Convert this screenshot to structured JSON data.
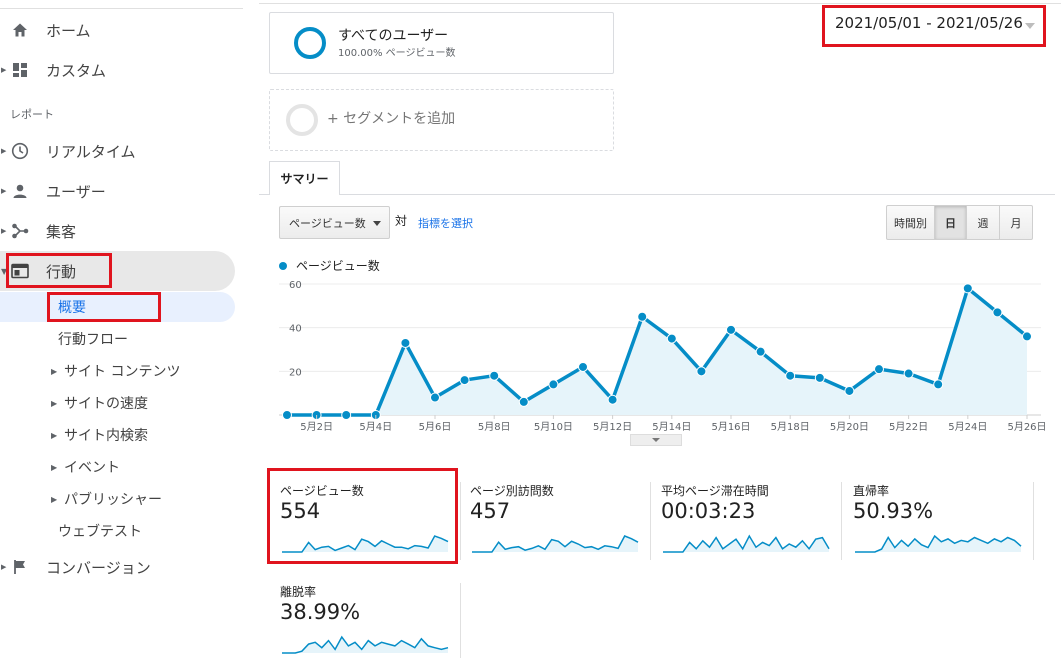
{
  "sidebar": {
    "home": "ホーム",
    "custom": "カスタム",
    "reports_label": "レポート",
    "realtime": "リアルタイム",
    "users": "ユーザー",
    "acquisition": "集客",
    "behavior": "行動",
    "overview": "概要",
    "behavior_flow": "行動フロー",
    "site_content": "サイト コンテンツ",
    "site_speed": "サイトの速度",
    "site_search": "サイト内検索",
    "events": "イベント",
    "publisher": "パブリッシャー",
    "experiments": "ウェブテスト",
    "conversions": "コンバージョン"
  },
  "segments": {
    "all_users_title": "すべてのユーザー",
    "all_users_sub": "100.00% ページビュー数",
    "add_segment": "+ セグメントを追加"
  },
  "date_range": "2021/05/01 - 2021/05/26",
  "tabs": {
    "summary": "サマリー"
  },
  "controls": {
    "metric_select": "ページビュー数",
    "vs": "対",
    "select_metric_link": "指標を選択",
    "granularity": [
      "時間別",
      "日",
      "週",
      "月"
    ],
    "granularity_active": "日"
  },
  "colors": {
    "accent": "#058dc7",
    "highlight": "#e0141e",
    "area_fill": "#e6f4fa"
  },
  "chart_data": {
    "type": "line",
    "series": [
      {
        "name": "ページビュー数",
        "values": [
          0,
          0,
          0,
          0,
          33,
          8,
          16,
          18,
          6,
          14,
          22,
          7,
          45,
          35,
          20,
          39,
          29,
          18,
          17,
          11,
          21,
          19,
          14,
          58,
          47,
          36
        ]
      }
    ],
    "x_days": [
      1,
      2,
      3,
      4,
      5,
      6,
      7,
      8,
      9,
      10,
      11,
      12,
      13,
      14,
      15,
      16,
      17,
      18,
      19,
      20,
      21,
      22,
      23,
      24,
      25,
      26
    ],
    "x_tick_labels": [
      "5月2日",
      "5月4日",
      "5月6日",
      "5月8日",
      "5月10日",
      "5月12日",
      "5月14日",
      "5月16日",
      "5月18日",
      "5月20日",
      "5月22日",
      "5月24日",
      "5月26日"
    ],
    "y_tick_labels": [
      "60",
      "40",
      "20"
    ],
    "ylim": [
      0,
      60
    ],
    "grid": true
  },
  "kpis": [
    {
      "label": "ページビュー数",
      "value": "554"
    },
    {
      "label": "ページ別訪問数",
      "value": "457"
    },
    {
      "label": "平均ページ滞在時間",
      "value": "00:03:23"
    },
    {
      "label": "直帰率",
      "value": "50.93%"
    },
    {
      "label": "離脱率",
      "value": "38.99%"
    }
  ]
}
